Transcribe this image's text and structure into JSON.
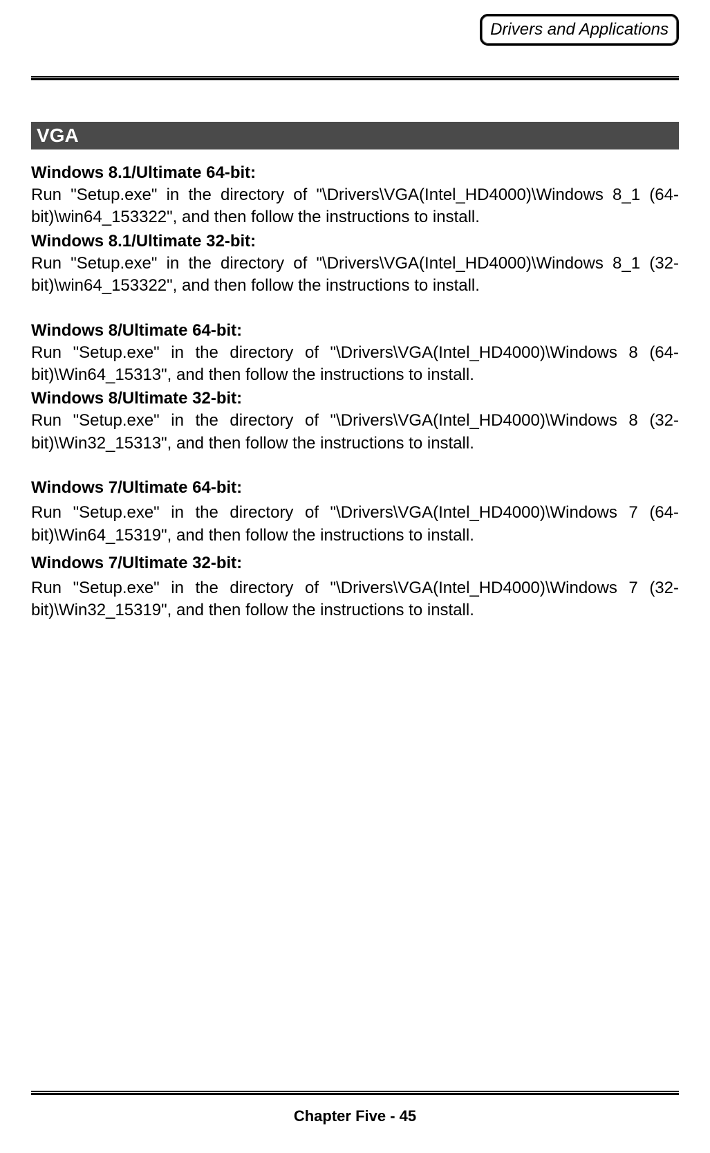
{
  "header": {
    "badge": "Drivers and Applications"
  },
  "section": {
    "title": "  VGA"
  },
  "entries": [
    {
      "heading": "Windows 8.1/Ultimate 64-bit:",
      "body": "Run \"Setup.exe\" in the directory of \"\\Drivers\\VGA(Intel_HD4000)\\Windows 8_1 (64-bit)\\win64_153322\", and then follow the instructions to install."
    },
    {
      "heading": "Windows 8.1/Ultimate 32-bit:",
      "body": "Run \"Setup.exe\" in the directory of \"\\Drivers\\VGA(Intel_HD4000)\\Windows 8_1 (32-bit)\\win64_153322\", and then follow the instructions to install."
    },
    {
      "heading": "Windows 8/Ultimate 64-bit:",
      "body": "Run \"Setup.exe\" in the directory of \"\\Drivers\\VGA(Intel_HD4000)\\Windows 8 (64-bit)\\Win64_15313\", and then follow the instructions to install."
    },
    {
      "heading": "Windows 8/Ultimate 32-bit:",
      "body": "Run \"Setup.exe\" in the directory of \"\\Drivers\\VGA(Intel_HD4000)\\Windows 8 (32-bit)\\Win32_15313\", and then follow the instructions to install."
    },
    {
      "heading": "Windows 7/Ultimate 64-bit:",
      "body": "Run \"Setup.exe\" in the directory of \"\\Drivers\\VGA(Intel_HD4000)\\Windows 7 (64-bit)\\Win64_15319\", and then follow the instructions to install."
    },
    {
      "heading": "Windows 7/Ultimate 32-bit:",
      "body": "Run \"Setup.exe\" in the directory of \"\\Drivers\\VGA(Intel_HD4000)\\Windows 7 (32-bit)\\Win32_15319\", and then follow the instructions to install."
    }
  ],
  "footer": {
    "page": "Chapter Five - 45"
  }
}
